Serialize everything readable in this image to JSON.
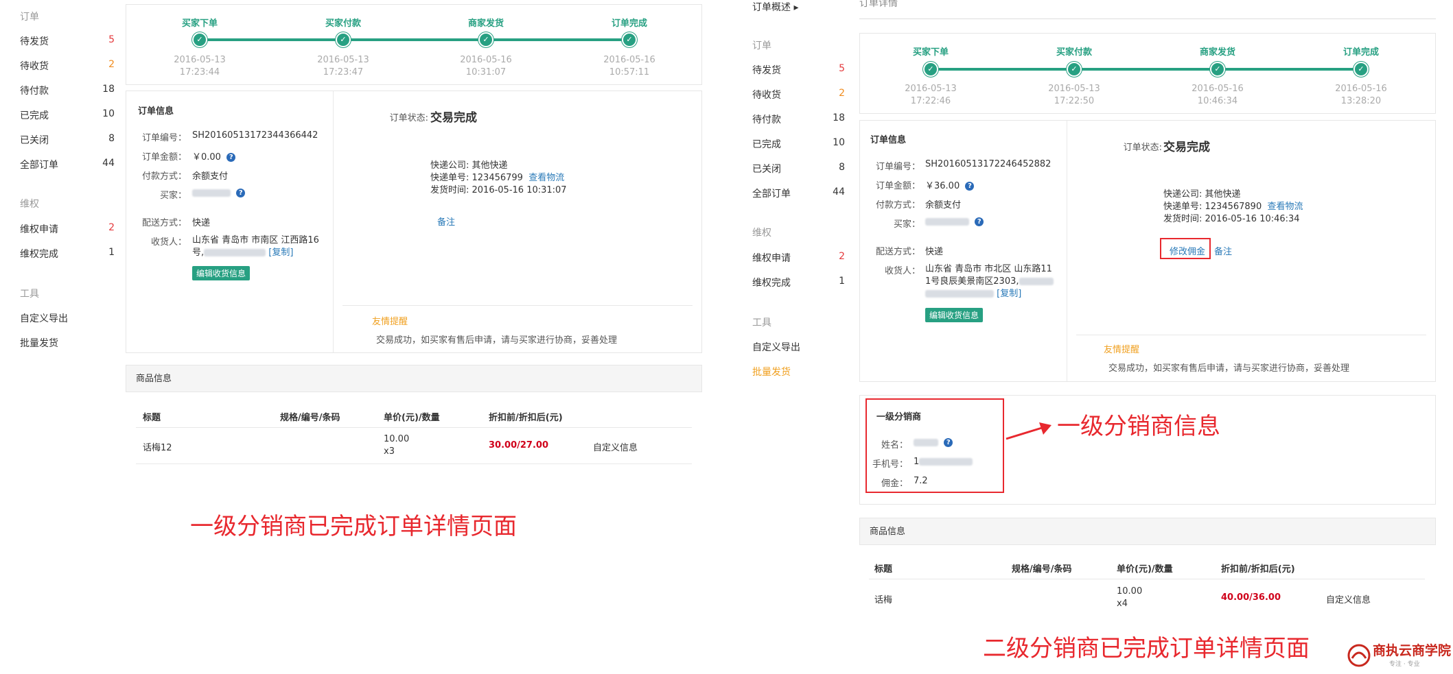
{
  "left": {
    "sidebar": {
      "section_orders": "订单",
      "items": [
        {
          "label": "待发货",
          "count": "5"
        },
        {
          "label": "待收货",
          "count": "2"
        },
        {
          "label": "待付款",
          "count": "18"
        },
        {
          "label": "已完成",
          "count": "10"
        },
        {
          "label": "已关闭",
          "count": "8"
        },
        {
          "label": "全部订单",
          "count": "44"
        }
      ],
      "section_rights": "维权",
      "rights": [
        {
          "label": "维权申请",
          "count": "2"
        },
        {
          "label": "维权完成",
          "count": "1"
        }
      ],
      "section_tools": "工具",
      "tools": [
        "自定义导出",
        "批量发货"
      ]
    },
    "steps": [
      {
        "label": "买家下单",
        "date": "2016-05-13",
        "time": "17:23:44"
      },
      {
        "label": "买家付款",
        "date": "2016-05-13",
        "time": "17:23:47"
      },
      {
        "label": "商家发货",
        "date": "2016-05-16",
        "time": "10:31:07"
      },
      {
        "label": "订单完成",
        "date": "2016-05-16",
        "time": "10:57:11"
      }
    ],
    "order_info": {
      "title": "订单信息",
      "order_no_label": "订单编号：",
      "order_no": "SH20160513172344366442",
      "amount_label": "订单金额：",
      "amount": "￥0.00",
      "pay_label": "付款方式：",
      "pay": "余额支付",
      "buyer_label": "买家：",
      "ship_method_label": "配送方式：",
      "ship_method": "快递",
      "receiver_label": "收货人：",
      "receiver_line1": "山东省 青岛市 市南区 江西路16",
      "receiver_line2": "号,",
      "copy": "[复制]",
      "edit_btn": "编辑收货信息"
    },
    "status": {
      "label": "订单状态:",
      "value": "交易完成",
      "express_company": "快递公司: 其他快递",
      "express_no": "快递单号: 123456799",
      "track": "查看物流",
      "ship_time": "发货时间: 2016-05-16 10:31:07",
      "remark": "备注",
      "hint_title": "友情提醒",
      "hint_text": "交易成功，如买家有售后申请，请与买家进行协商，妥善处理"
    },
    "products": {
      "section": "商品信息",
      "headers": [
        "标题",
        "规格/编号/条码",
        "单价(元)/数量",
        "折扣前/折扣后(元)"
      ],
      "row": {
        "title": "话梅12",
        "unit": "10.00",
        "qty": "x3",
        "price": "30.00/27.00",
        "link": "自定义信息"
      }
    },
    "caption": "一级分销商已完成订单详情页面"
  },
  "right": {
    "top_link": "订单概述",
    "page_title": "订单详情",
    "sidebar": {
      "section_orders": "订单",
      "items": [
        {
          "label": "待发货",
          "count": "5"
        },
        {
          "label": "待收货",
          "count": "2"
        },
        {
          "label": "待付款",
          "count": "18"
        },
        {
          "label": "已完成",
          "count": "10"
        },
        {
          "label": "已关闭",
          "count": "8"
        },
        {
          "label": "全部订单",
          "count": "44"
        }
      ],
      "section_rights": "维权",
      "rights": [
        {
          "label": "维权申请",
          "count": "2"
        },
        {
          "label": "维权完成",
          "count": "1"
        }
      ],
      "section_tools": "工具",
      "tools": [
        "自定义导出",
        "批量发货"
      ]
    },
    "steps": [
      {
        "label": "买家下单",
        "date": "2016-05-13",
        "time": "17:22:46"
      },
      {
        "label": "买家付款",
        "date": "2016-05-13",
        "time": "17:22:50"
      },
      {
        "label": "商家发货",
        "date": "2016-05-16",
        "time": "10:46:34"
      },
      {
        "label": "订单完成",
        "date": "2016-05-16",
        "time": "13:28:20"
      }
    ],
    "order_info": {
      "title": "订单信息",
      "order_no_label": "订单编号：",
      "order_no": "SH20160513172246452882",
      "amount_label": "订单金额：",
      "amount": "￥36.00",
      "pay_label": "付款方式：",
      "pay": "余额支付",
      "buyer_label": "买家：",
      "ship_method_label": "配送方式：",
      "ship_method": "快递",
      "receiver_label": "收货人：",
      "receiver_line1": "山东省 青岛市 市北区 山东路11",
      "receiver_line2": "1号良辰美景南区2303,",
      "copy": "[复制]",
      "edit_btn": "编辑收货信息"
    },
    "status": {
      "label": "订单状态:",
      "value": "交易完成",
      "express_company": "快递公司: 其他快递",
      "express_no": "快递单号: 1234567890",
      "track": "查看物流",
      "ship_time": "发货时间: 2016-05-16 10:46:34",
      "edit_commission": "修改佣金",
      "remark": "备注",
      "hint_title": "友情提醒",
      "hint_text": "交易成功，如买家有售后申请，请与买家进行协商，妥善处理"
    },
    "distributor": {
      "title": "一级分销商",
      "name_label": "姓名：",
      "phone_label": "手机号：",
      "phone_partial": "1",
      "commission_label": "佣金：",
      "commission": "7.2",
      "annotation": "一级分销商信息"
    },
    "products": {
      "section": "商品信息",
      "headers": [
        "标题",
        "规格/编号/条码",
        "单价(元)/数量",
        "折扣前/折扣后(元)"
      ],
      "row": {
        "title": "话梅",
        "unit": "10.00",
        "qty": "x4",
        "price": "40.00/36.00",
        "link": "自定义信息"
      }
    },
    "caption": "二级分销商已完成订单详情页面",
    "logo_text": "商执云商学院",
    "logo_sub": "专注 · 专业"
  },
  "colors": {
    "accent": "#27a082",
    "highlight": "#e8282e",
    "link": "#2a7ab8",
    "warning": "#f0a020"
  }
}
